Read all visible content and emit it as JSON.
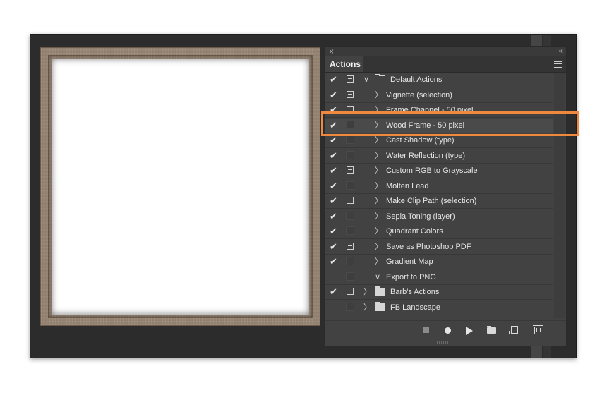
{
  "panel": {
    "close_glyph": "×",
    "collapse_glyph": "‹‹",
    "tab_label": "Actions"
  },
  "actions": [
    {
      "label": "Default Actions",
      "checked": true,
      "dialog": "box",
      "type": "folder",
      "expanded": true
    },
    {
      "label": "Vignette (selection)",
      "checked": true,
      "dialog": "box",
      "type": "action",
      "expanded": false
    },
    {
      "label": "Frame Channel - 50 pixel",
      "checked": true,
      "dialog": "box",
      "type": "action",
      "expanded": false
    },
    {
      "label": "Wood Frame - 50 pixel",
      "checked": true,
      "dialog": "none",
      "type": "action",
      "expanded": false,
      "selected": true
    },
    {
      "label": "Cast Shadow (type)",
      "checked": true,
      "dialog": "none",
      "type": "action",
      "expanded": false
    },
    {
      "label": "Water Reflection (type)",
      "checked": true,
      "dialog": "none",
      "type": "action",
      "expanded": false
    },
    {
      "label": "Custom RGB to Grayscale",
      "checked": true,
      "dialog": "box",
      "type": "action",
      "expanded": false
    },
    {
      "label": "Molten Lead",
      "checked": true,
      "dialog": "none",
      "type": "action",
      "expanded": false
    },
    {
      "label": "Make Clip Path (selection)",
      "checked": true,
      "dialog": "box",
      "type": "action",
      "expanded": false
    },
    {
      "label": "Sepia Toning (layer)",
      "checked": true,
      "dialog": "none",
      "type": "action",
      "expanded": false
    },
    {
      "label": "Quadrant Colors",
      "checked": true,
      "dialog": "none",
      "type": "action",
      "expanded": false
    },
    {
      "label": "Save as Photoshop PDF",
      "checked": true,
      "dialog": "box",
      "type": "action",
      "expanded": false
    },
    {
      "label": "Gradient Map",
      "checked": true,
      "dialog": "none",
      "type": "action",
      "expanded": false
    },
    {
      "label": "Export to PNG",
      "checked": false,
      "dialog": "none",
      "type": "action",
      "expanded": true
    },
    {
      "label": "Barb's Actions",
      "checked": true,
      "dialog": "box",
      "type": "folder",
      "expanded": false
    },
    {
      "label": "FB Landscape",
      "checked": false,
      "dialog": "none",
      "type": "folder",
      "expanded": false
    }
  ],
  "glyphs": {
    "check": "✔",
    "chevron_right": "〉",
    "chevron_down": "∨"
  },
  "colors": {
    "highlight": "#f0883e",
    "panel_bg": "#424242",
    "app_bg": "#2c2c2c"
  },
  "footer": {
    "buttons": [
      "stop-icon",
      "record-icon",
      "play-icon",
      "new-set-icon",
      "new-action-icon",
      "trash-icon"
    ]
  }
}
